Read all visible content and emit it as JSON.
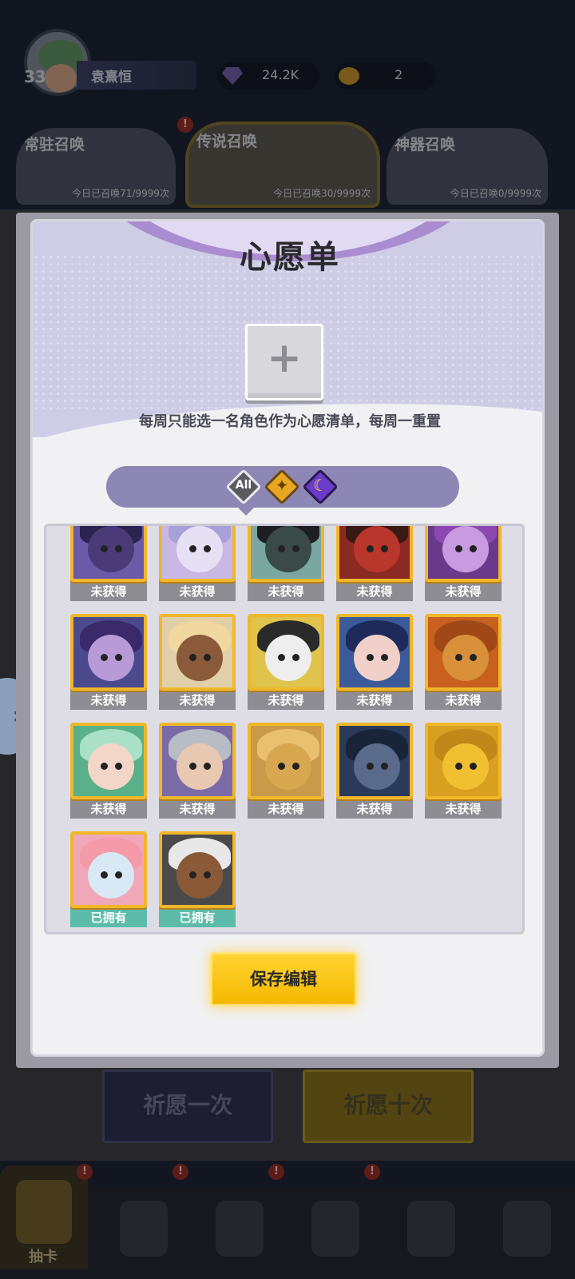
{
  "player": {
    "level": "33",
    "name": "袁熹恒"
  },
  "resources": {
    "gems": "24.2K",
    "coins": "2"
  },
  "banners": [
    {
      "title": "常驻召唤",
      "count": "今日已召唤71/9999次",
      "active": false
    },
    {
      "title": "传说召唤",
      "count": "今日已召唤30/9999次",
      "active": true
    },
    {
      "title": "神器召唤",
      "count": "今日已召唤0/9999次",
      "active": false
    }
  ],
  "alert_glyph": "!",
  "side_arrow": "›",
  "actions": {
    "pray_once": "祈愿一次",
    "pray_ten": "祈愿十次"
  },
  "nav": {
    "draw_label": "抽卡"
  },
  "wishlist": {
    "title": "心愿单",
    "add_symbol": "+",
    "description": "每周只能选一名角色作为心愿清单，每周一重置",
    "filters": {
      "all": "All",
      "gold_glyph": "✦",
      "purple_glyph": "☾"
    },
    "save_label": "保存编辑",
    "heroes": [
      {
        "status": "未获得",
        "owned": false,
        "bg": "#6a5aa8",
        "face": "#4a3a78",
        "hair": "#2b2350"
      },
      {
        "status": "未获得",
        "owned": false,
        "bg": "#c9b8e6",
        "face": "#e6e0f5",
        "hair": "#a8a0d8"
      },
      {
        "status": "未获得",
        "owned": false,
        "bg": "#7aa8a0",
        "face": "#3a4a48",
        "hair": "#1e1e22"
      },
      {
        "status": "未获得",
        "owned": false,
        "bg": "#8a2a22",
        "face": "#b8362c",
        "hair": "#3a1a14"
      },
      {
        "status": "未获得",
        "owned": false,
        "bg": "#6a3a8a",
        "face": "#c89ae0",
        "hair": "#8a48b0"
      },
      {
        "status": "未获得",
        "owned": false,
        "bg": "#4a4a8c",
        "face": "#b89ad8",
        "hair": "#3a2a6a"
      },
      {
        "status": "未获得",
        "owned": false,
        "bg": "#e0cfa8",
        "face": "#8a5a3a",
        "hair": "#f0d8a0"
      },
      {
        "status": "未获得",
        "owned": false,
        "bg": "#e0c34a",
        "face": "#eeeeee",
        "hair": "#2a2a2a"
      },
      {
        "status": "未获得",
        "owned": false,
        "bg": "#3a5a9a",
        "face": "#f0d0c8",
        "hair": "#1e2a5a"
      },
      {
        "status": "未获得",
        "owned": false,
        "bg": "#c8601e",
        "face": "#d8903a",
        "hair": "#a04818"
      },
      {
        "status": "未获得",
        "owned": false,
        "bg": "#5ab088",
        "face": "#f4d6c8",
        "hair": "#a8e0c8"
      },
      {
        "status": "未获得",
        "owned": false,
        "bg": "#7a6aa8",
        "face": "#e8c8b0",
        "hair": "#b8bcc4"
      },
      {
        "status": "未获得",
        "owned": false,
        "bg": "#c89a4a",
        "face": "#d8a850",
        "hair": "#e8c070"
      },
      {
        "status": "未获得",
        "owned": false,
        "bg": "#2a3a5a",
        "face": "#5a6a8a",
        "hair": "#1a2438"
      },
      {
        "status": "未获得",
        "owned": false,
        "bg": "#d8a020",
        "face": "#f0c030",
        "hair": "#c08818"
      },
      {
        "status": "已拥有",
        "owned": true,
        "bg": "#f0a8b8",
        "face": "#d8e8f4",
        "hair": "#f49aa8"
      },
      {
        "status": "已拥有",
        "owned": true,
        "bg": "#4a4a4a",
        "face": "#8a5a38",
        "hair": "#e8e8e8"
      }
    ]
  }
}
